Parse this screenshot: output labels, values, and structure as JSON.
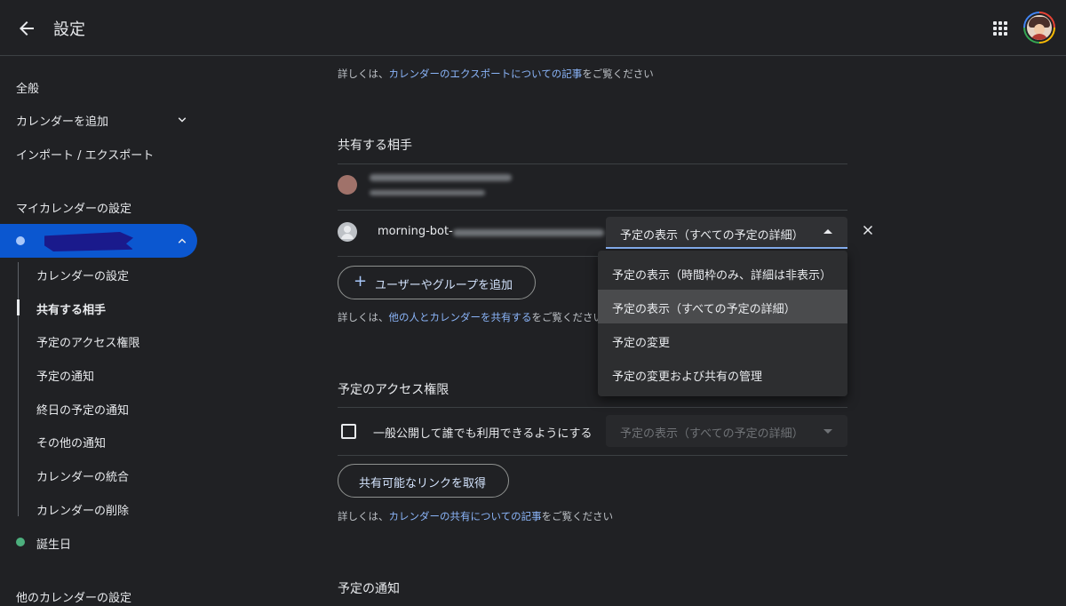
{
  "header": {
    "title": "設定",
    "back_icon": "arrow-back-icon",
    "apps_icon": "apps-grid-icon"
  },
  "sidebar": {
    "general": "全般",
    "add_calendar": "カレンダーを追加",
    "import_export": "インポート / エクスポート",
    "my_calendars_title": "マイカレンダーの設定",
    "sub_items": [
      "カレンダーの設定",
      "共有する相手",
      "予定のアクセス権限",
      "予定の通知",
      "終日の予定の通知",
      "その他の通知",
      "カレンダーの統合",
      "カレンダーの削除"
    ],
    "birthday": "誕生日",
    "other_calendars_title": "他のカレンダーの設定",
    "active_color": "#0b57d0",
    "birthday_color": "#4caf7d"
  },
  "main": {
    "export_note": {
      "prefix": "詳しくは、",
      "link": "カレンダーのエクスポートについての記事",
      "suffix": "をご覧ください"
    },
    "share_title": "共有する相手",
    "member_name": "morning-bot-",
    "member_permission": "予定の表示（すべての予定の詳細）",
    "add_user_button": "ユーザーやグループを追加",
    "share_note": {
      "prefix": "詳しくは、",
      "link": "他の人とカレンダーを共有する",
      "suffix": "をご覧ください"
    },
    "access_title": "予定のアクセス権限",
    "public_checkbox_label": "一般公開して誰でも利用できるようにする",
    "public_permission": "予定の表示（すべての予定の詳細）",
    "get_link_button": "共有可能なリンクを取得",
    "access_note": {
      "prefix": "詳しくは、",
      "link": "カレンダーの共有についての記事",
      "suffix": "をご覧ください"
    },
    "notify_title": "予定の通知"
  },
  "dropdown": {
    "options": [
      "予定の表示（時間枠のみ、詳細は非表示）",
      "予定の表示（すべての予定の詳細）",
      "予定の変更",
      "予定の変更および共有の管理"
    ],
    "selected": "予定の表示（すべての予定の詳細）"
  }
}
